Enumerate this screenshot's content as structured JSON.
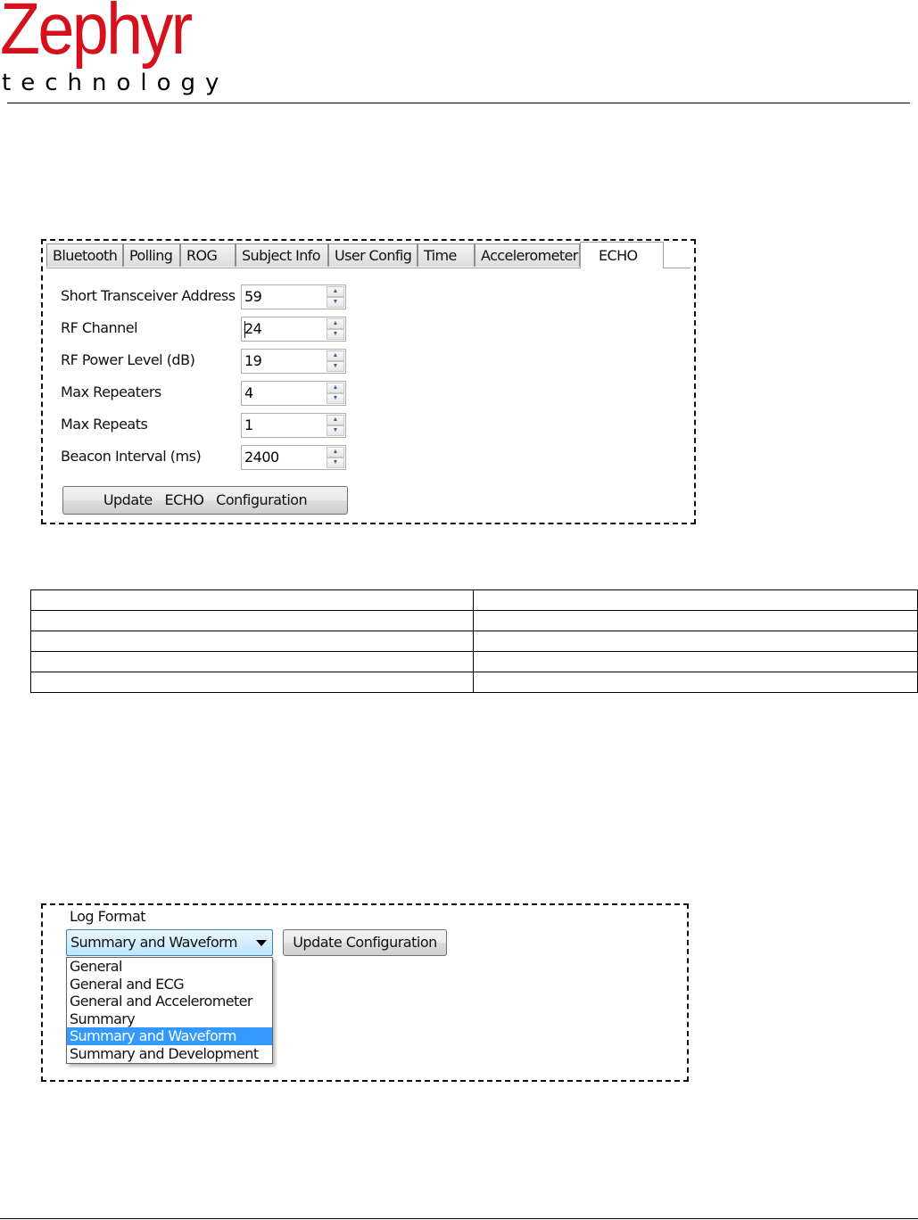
{
  "header": {
    "logo_word": "Zephyr",
    "logo_sub": "technology"
  },
  "echo_panel": {
    "tabs": [
      "Bluetooth",
      "Polling",
      "ROG",
      "Subject Info",
      "User Config",
      "Time",
      "Accelerometer",
      "ECHO"
    ],
    "active_tab": "ECHO",
    "fields": [
      {
        "label": "Short Transceiver Address",
        "value": "59"
      },
      {
        "label": "RF Channel",
        "value": "24"
      },
      {
        "label": "RF Power Level (dB)",
        "value": "19"
      },
      {
        "label": "Max Repeaters",
        "value": "4"
      },
      {
        "label": "Max Repeats",
        "value": "1"
      },
      {
        "label": "Beacon Interval (ms)",
        "value": "2400"
      }
    ],
    "update_button": "Update   ECHO   Configuration"
  },
  "table": {
    "rows": [
      [
        "",
        ""
      ],
      [
        "",
        ""
      ],
      [
        "",
        ""
      ],
      [
        "",
        ""
      ],
      [
        "",
        ""
      ]
    ]
  },
  "log_panel": {
    "group_label": "Log Format",
    "selected_value": "Summary and Waveform",
    "update_button": "Update Configuration",
    "options": [
      "General",
      "General and ECG",
      "General and Accelerometer",
      "Summary",
      "Summary and Waveform",
      "Summary and Development"
    ],
    "highlighted_index": 4
  },
  "colors": {
    "logo_red": "#d4121d",
    "selection_blue": "#3399ff"
  }
}
